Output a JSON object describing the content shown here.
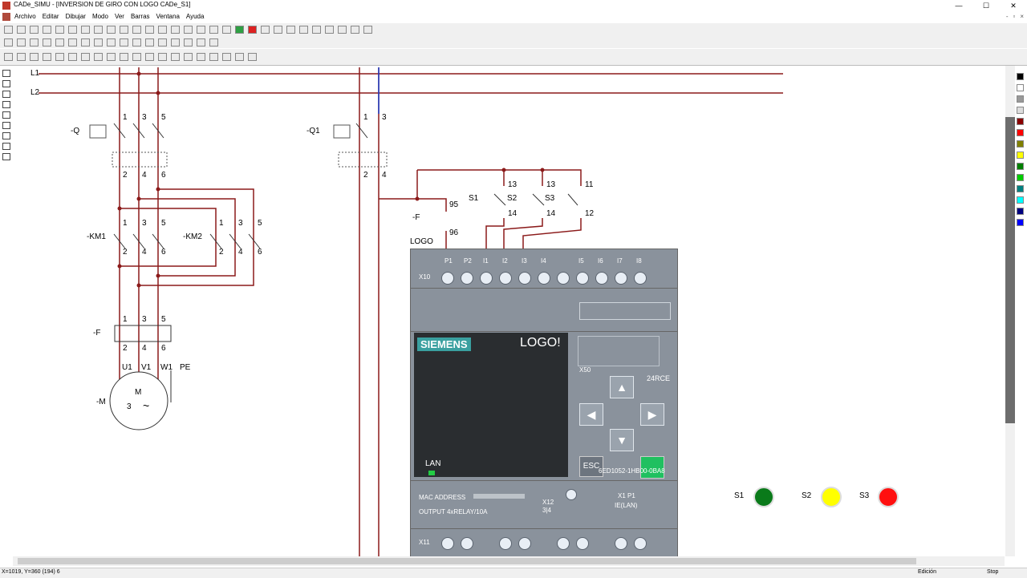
{
  "window": {
    "title": "CADe_SIMU - [INVERSION DE GIRO CON LOGO CADe_S1]",
    "controls": [
      "—",
      "☐",
      "✕"
    ]
  },
  "menu": {
    "items": [
      "Archivo",
      "Editar",
      "Dibujar",
      "Modo",
      "Ver",
      "Barras",
      "Ventana",
      "Ayuda"
    ],
    "mdi_controls": [
      "-",
      "▫",
      "×"
    ]
  },
  "power_circuit": {
    "rails": [
      "L1",
      "L2"
    ],
    "breaker": {
      "tag": "-Q",
      "top_terms": [
        "1",
        "3",
        "5"
      ],
      "bottom_terms": [
        "2",
        "4",
        "6"
      ]
    },
    "contactor1": {
      "tag": "-KM1",
      "top_terms": [
        "1",
        "3",
        "5"
      ],
      "bottom_terms": [
        "2",
        "4",
        "6"
      ]
    },
    "contactor2": {
      "tag": "-KM2",
      "top_terms": [
        "1",
        "3",
        "5"
      ],
      "bottom_terms": [
        "2",
        "4",
        "6"
      ]
    },
    "relay": {
      "tag": "-F",
      "top_terms": [
        "1",
        "3",
        "5"
      ],
      "bottom_terms": [
        "2",
        "4",
        "6"
      ]
    },
    "motor": {
      "tag": "-M",
      "phases": [
        "U1",
        "V1",
        "W1",
        "PE"
      ],
      "symbol": "M",
      "count": "3",
      "ac": "~"
    }
  },
  "control_circuit": {
    "breaker": {
      "tag": "-Q1",
      "top_terms": [
        "1",
        "3"
      ],
      "bottom_terms": [
        "2",
        "4"
      ]
    },
    "thermal": {
      "tag": "-F",
      "terms": [
        "95",
        "96"
      ]
    },
    "logo_label": "LOGO",
    "s1": {
      "tag": "S1",
      "terms": [
        "13",
        "14"
      ]
    },
    "s2": {
      "tag": "S2",
      "terms": [
        "13",
        "14"
      ]
    },
    "s3": {
      "tag": "S3",
      "terms": [
        "11",
        "12"
      ]
    }
  },
  "logo": {
    "inputs": [
      "P1",
      "P2",
      "I1",
      "I2",
      "I3",
      "I4",
      "I5",
      "I6",
      "I7",
      "I8"
    ],
    "connector_top": "X10",
    "brand": "SIEMENS",
    "model": "LOGO!",
    "variant": "24RCE",
    "x50": "X50",
    "lan": "LAN",
    "part": "6ED1052-1HB00-0BA8",
    "esc": "ESC",
    "mac": "MAC ADDRESS",
    "output": "OUTPUT 4xRELAY/10A",
    "x12": "X12",
    "x12_terms": "3|4",
    "x1": "X1 P1",
    "x1b": "IE(LAN)",
    "connector_bottom": "X11",
    "arrows": {
      "up": "▲",
      "left": "◀",
      "right": "▶",
      "down": "▼"
    }
  },
  "indicators": [
    {
      "label": "S1",
      "color": "#0a7a1a"
    },
    {
      "label": "S2",
      "color": "#ffff00"
    },
    {
      "label": "S3",
      "color": "#ff1010"
    }
  ],
  "status": {
    "coords": "X=1019, Y=360 (194) 6",
    "mode": "Edición",
    "state": "Stop"
  }
}
